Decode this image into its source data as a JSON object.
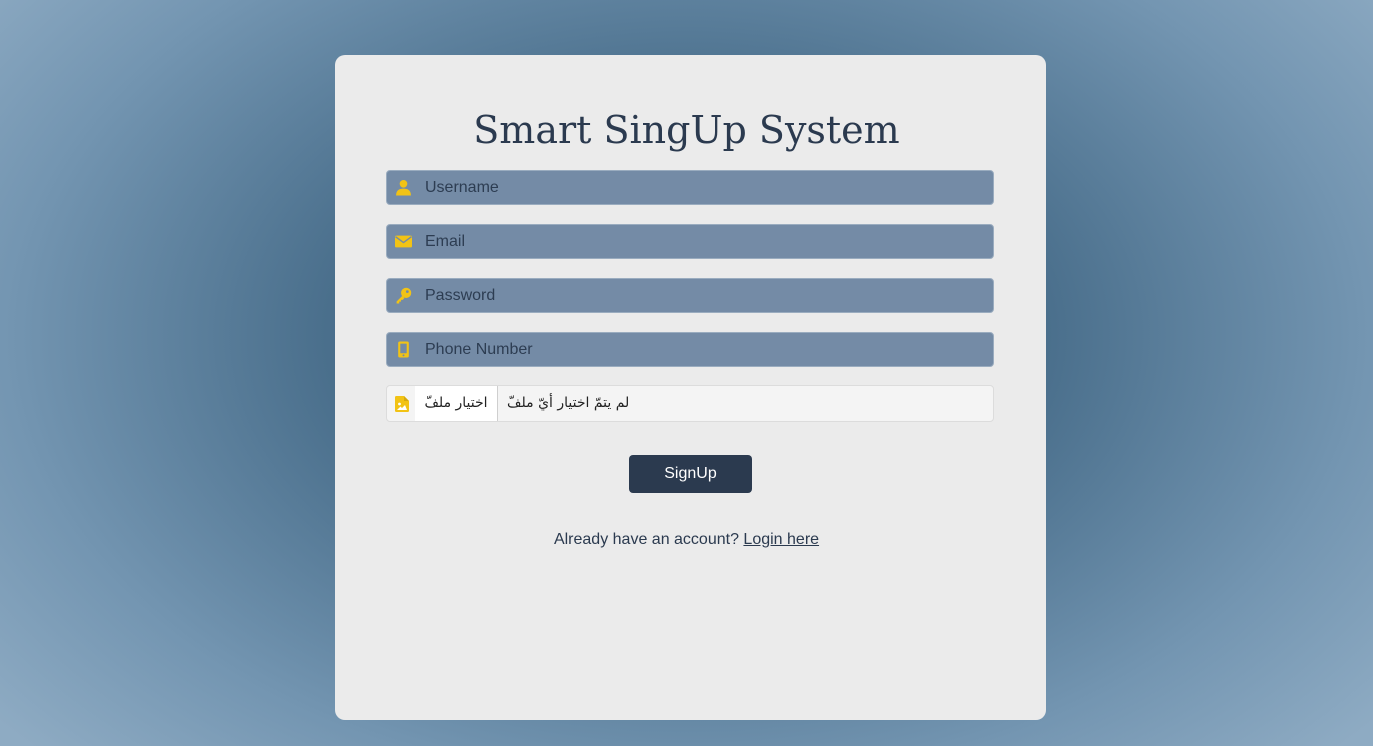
{
  "form": {
    "title": "Smart SingUp System",
    "username": {
      "placeholder": "Username",
      "value": ""
    },
    "email": {
      "placeholder": "Email",
      "value": ""
    },
    "password": {
      "placeholder": "Password",
      "value": ""
    },
    "phone": {
      "placeholder": "Phone Number",
      "value": ""
    },
    "file": {
      "button_label": "اختيار ملفّ",
      "status_text": "لم يتمّ اختيار أيّ ملفّ"
    },
    "submit_label": "SignUp",
    "login_prompt": "Already have an account?",
    "login_link": "Login here"
  },
  "icons": {
    "username": "user-icon",
    "email": "envelope-icon",
    "password": "key-icon",
    "phone": "mobile-icon",
    "file": "image-file-icon"
  },
  "colors": {
    "accent": "#f2c315",
    "primary": "#2b3a4f",
    "input_bg": "#748ba6",
    "card_bg": "#ebebeb"
  }
}
